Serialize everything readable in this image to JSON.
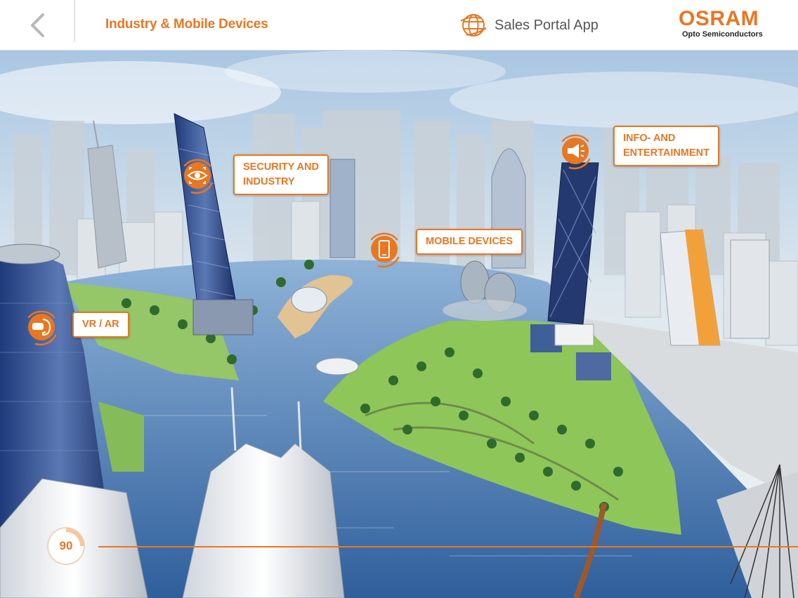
{
  "header": {
    "back_icon": "chevron-left-icon",
    "title": "Industry & Mobile Devices",
    "portal_icon": "globe-icon",
    "portal_label": "Sales Portal App",
    "logo_main": "OSRAM",
    "logo_sub": "Opto Semiconductors"
  },
  "hotspots": [
    {
      "id": "security",
      "label_line1": "SECURITY AND",
      "label_line2": "INDUSTRY",
      "icon": "eye-icon"
    },
    {
      "id": "info",
      "label_line1": "INFO- AND",
      "label_line2": "ENTERTAINMENT",
      "icon": "megaphone-icon"
    },
    {
      "id": "mobile",
      "label_line1": "MOBILE DEVICES",
      "icon": "smartphone-icon"
    },
    {
      "id": "vrar",
      "label_line1": "VR / AR",
      "icon": "vr-headset-icon"
    }
  ],
  "view": {
    "degree": "90"
  },
  "colors": {
    "accent": "#e87722",
    "water": "#3f6fa8",
    "sky": "#dbe8f2",
    "grass": "#8fc65a"
  }
}
